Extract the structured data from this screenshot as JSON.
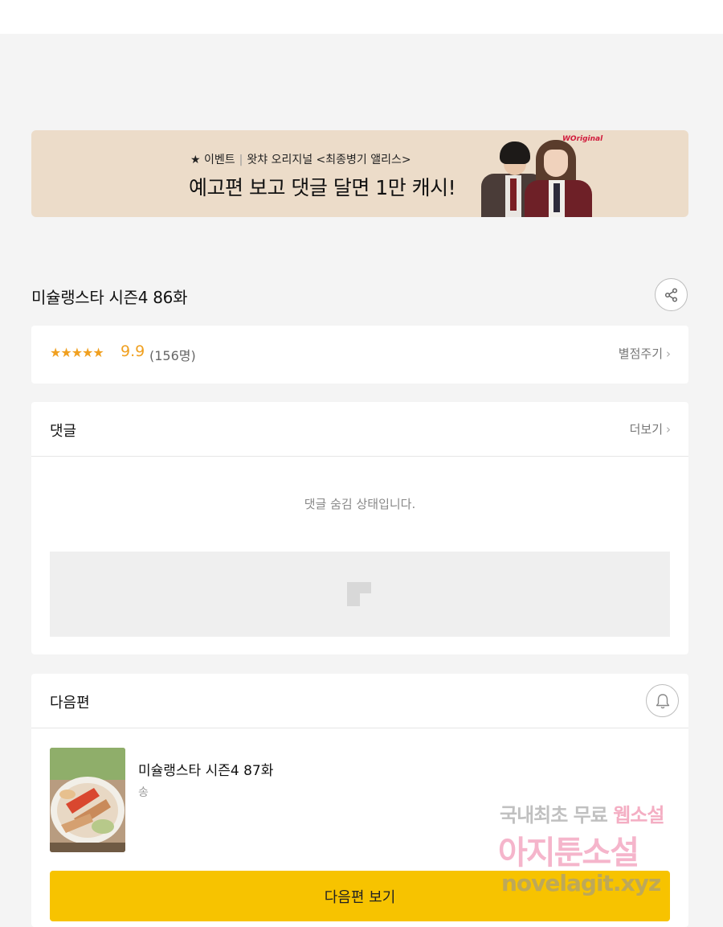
{
  "banner": {
    "event_label": "★ 이벤트",
    "separator": "|",
    "subtitle": "왓챠 오리지널 <최종병기 앨리스>",
    "headline": "예고편 보고 댓글 달면 1만 캐시!",
    "logo_text": "WOriginal"
  },
  "episode": {
    "title": "미슐랭스타 시즌4 86화",
    "share_icon": "share-icon"
  },
  "rating": {
    "stars": "★★★★★",
    "score": "9.9",
    "count": "(156명)",
    "rate_label": "별점주기",
    "chevron": "›"
  },
  "comments": {
    "heading": "댓글",
    "more_label": "더보기",
    "chevron": "›",
    "hidden_message": "댓글 숨김 상태입니다."
  },
  "next": {
    "heading": "다음편",
    "bell_icon": "bell-icon",
    "title": "미슐랭스타 시즌4 87화",
    "author": "송",
    "button_label": "다음편 보기"
  },
  "watermark": {
    "line1_gray": "국내최초 무료",
    "line1_pink": "웹소설",
    "line2": "아지툰소설",
    "line3": "novelagit.xyz"
  },
  "colors": {
    "accent_yellow": "#f7c300",
    "star_orange": "#f0a020",
    "banner_bg": "#ecdcc9",
    "page_bg": "#f4f4f4"
  }
}
